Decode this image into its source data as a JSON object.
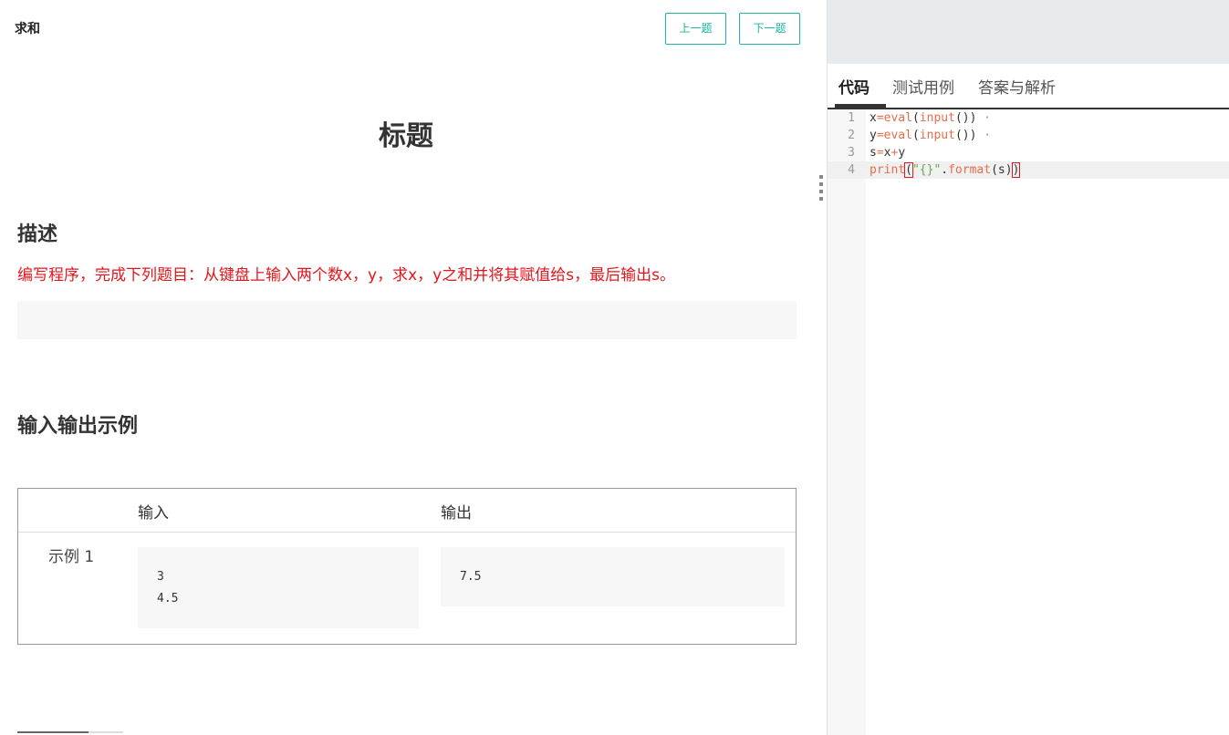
{
  "problem": {
    "name": "求和",
    "prev_label": "上一题",
    "next_label": "下一题",
    "title": "标题",
    "desc_heading": "描述",
    "description": "编写程序，完成下列题目：从键盘上输入两个数x，y，求x，y之和并将其赋值给s，最后输出s。",
    "io_heading": "输入输出示例",
    "io_table": {
      "input_header": "输入",
      "output_header": "输出",
      "rows": [
        {
          "label": "示例 1",
          "input_lines": [
            "3",
            "4.5"
          ],
          "output_lines": [
            "7.5"
          ]
        }
      ]
    }
  },
  "tabs": [
    {
      "label": "代码",
      "active": true
    },
    {
      "label": "测试用例",
      "active": false
    },
    {
      "label": "答案与解析",
      "active": false
    }
  ],
  "editor": {
    "lines": [
      {
        "num": "1",
        "text": "x=eval(input())"
      },
      {
        "num": "2",
        "text": "y=eval(input())"
      },
      {
        "num": "3",
        "text": "s=x+y"
      },
      {
        "num": "4",
        "text": "print(\"{}\".format(s))"
      }
    ],
    "active_line": 4
  },
  "colors": {
    "accent": "#1bb5a0",
    "description_text": "#e4161b",
    "keyword": "#e96d4b",
    "string": "#6aa84f"
  }
}
